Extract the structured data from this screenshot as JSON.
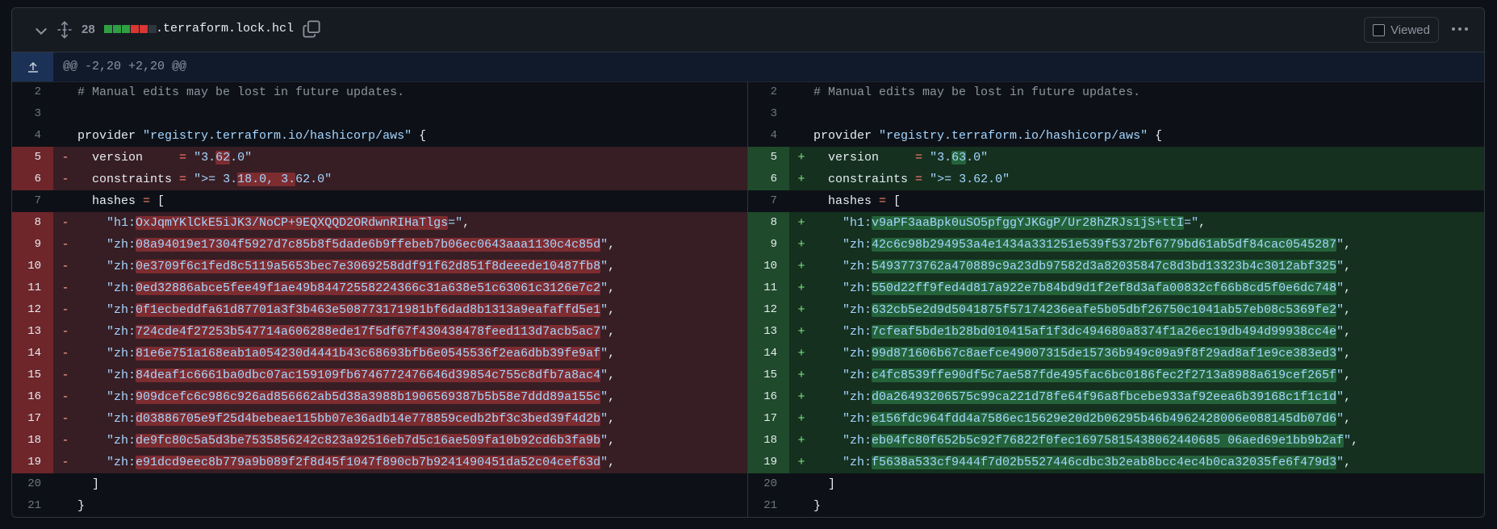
{
  "file_header": {
    "changes_count": "28",
    "diffstat": [
      "#2ea043",
      "#2ea043",
      "#2ea043",
      "#da3633",
      "#da3633",
      "#30363d"
    ],
    "file_name": ".terraform.lock.hcl",
    "viewed_label": "Viewed"
  },
  "hunk": {
    "header": "@@ -2,20 +2,20 @@"
  },
  "colors": {
    "deletion": "#371e24",
    "addition": "#15301f",
    "string": "#a5d6ff",
    "operator": "#ff7b72",
    "comment": "#8b949e"
  },
  "left_lines": [
    {
      "num": "2",
      "type": "ctx",
      "sign": "",
      "parts": [
        [
          "com",
          "# Manual edits may be lost in future updates."
        ]
      ]
    },
    {
      "num": "3",
      "type": "ctx",
      "sign": "",
      "parts": []
    },
    {
      "num": "4",
      "type": "ctx",
      "sign": "",
      "parts": [
        [
          "txt",
          "provider "
        ],
        [
          "str",
          "\"registry.terraform.io/hashicorp/aws\""
        ],
        [
          "txt",
          " {"
        ]
      ]
    },
    {
      "num": "5",
      "type": "del",
      "sign": "-",
      "parts": [
        [
          "txt",
          "  version     "
        ],
        [
          "op",
          "="
        ],
        [
          "txt",
          " "
        ],
        [
          "str",
          "\"3."
        ],
        [
          "hlstr",
          "62"
        ],
        [
          "str",
          ".0\""
        ]
      ]
    },
    {
      "num": "6",
      "type": "del",
      "sign": "-",
      "parts": [
        [
          "txt",
          "  constraints "
        ],
        [
          "op",
          "="
        ],
        [
          "txt",
          " "
        ],
        [
          "str",
          "\">= 3."
        ],
        [
          "hlstr",
          "18.0, 3."
        ],
        [
          "str",
          "62.0\""
        ]
      ]
    },
    {
      "num": "7",
      "type": "ctx",
      "sign": "",
      "parts": [
        [
          "txt",
          "  hashes "
        ],
        [
          "op",
          "="
        ],
        [
          "txt",
          " ["
        ]
      ]
    },
    {
      "num": "8",
      "type": "del",
      "sign": "-",
      "parts": [
        [
          "txt",
          "    "
        ],
        [
          "str",
          "\"h1:"
        ],
        [
          "hlstr",
          "OxJqmYKlCkE5iJK3/NoCP+9EQXQQD2ORdwnRIHaTlgs"
        ],
        [
          "str",
          "=\""
        ],
        [
          "txt",
          ","
        ]
      ]
    },
    {
      "num": "9",
      "type": "del",
      "sign": "-",
      "parts": [
        [
          "txt",
          "    "
        ],
        [
          "str",
          "\"zh:"
        ],
        [
          "hlstr",
          "08a94019e17304f5927d7c85b8f5dade6b9ffebeb7b06ec0643aaa1130c4c85d"
        ],
        [
          "str",
          "\""
        ],
        [
          "txt",
          ","
        ]
      ]
    },
    {
      "num": "10",
      "type": "del",
      "sign": "-",
      "parts": [
        [
          "txt",
          "    "
        ],
        [
          "str",
          "\"zh:"
        ],
        [
          "hlstr",
          "0e3709f6c1fed8c5119a5653bec7e3069258ddf91f62d851f8deeede10487fb8"
        ],
        [
          "str",
          "\""
        ],
        [
          "txt",
          ","
        ]
      ]
    },
    {
      "num": "11",
      "type": "del",
      "sign": "-",
      "parts": [
        [
          "txt",
          "    "
        ],
        [
          "str",
          "\"zh:"
        ],
        [
          "hlstr",
          "0ed32886abce5fee49f1ae49b84472558224366c31a638e51c63061c3126e7c2"
        ],
        [
          "str",
          "\""
        ],
        [
          "txt",
          ","
        ]
      ]
    },
    {
      "num": "12",
      "type": "del",
      "sign": "-",
      "parts": [
        [
          "txt",
          "    "
        ],
        [
          "str",
          "\"zh:"
        ],
        [
          "hlstr",
          "0f1ecbeddfa61d87701a3f3b463e508773171981bf6dad8b1313a9eafaffd5e1"
        ],
        [
          "str",
          "\""
        ],
        [
          "txt",
          ","
        ]
      ]
    },
    {
      "num": "13",
      "type": "del",
      "sign": "-",
      "parts": [
        [
          "txt",
          "    "
        ],
        [
          "str",
          "\"zh:"
        ],
        [
          "hlstr",
          "724cde4f27253b547714a606288ede17f5df67f430438478feed113d7acb5ac7"
        ],
        [
          "str",
          "\""
        ],
        [
          "txt",
          ","
        ]
      ]
    },
    {
      "num": "14",
      "type": "del",
      "sign": "-",
      "parts": [
        [
          "txt",
          "    "
        ],
        [
          "str",
          "\"zh:"
        ],
        [
          "hlstr",
          "81e6e751a168eab1a054230d4441b43c68693bfb6e0545536f2ea6dbb39fe9af"
        ],
        [
          "str",
          "\""
        ],
        [
          "txt",
          ","
        ]
      ]
    },
    {
      "num": "15",
      "type": "del",
      "sign": "-",
      "parts": [
        [
          "txt",
          "    "
        ],
        [
          "str",
          "\"zh:"
        ],
        [
          "hlstr",
          "84deaf1c6661ba0dbc07ac159109fb6746772476646d39854c755c8dfb7a8ac4"
        ],
        [
          "str",
          "\""
        ],
        [
          "txt",
          ","
        ]
      ]
    },
    {
      "num": "16",
      "type": "del",
      "sign": "-",
      "parts": [
        [
          "txt",
          "    "
        ],
        [
          "str",
          "\"zh:"
        ],
        [
          "hlstr",
          "909dcefc6c986c926ad856662ab5d38a3988b1906569387b5b58e7ddd89a155c"
        ],
        [
          "str",
          "\""
        ],
        [
          "txt",
          ","
        ]
      ]
    },
    {
      "num": "17",
      "type": "del",
      "sign": "-",
      "parts": [
        [
          "txt",
          "    "
        ],
        [
          "str",
          "\"zh:"
        ],
        [
          "hlstr",
          "d03886705e9f25d4bebeae115bb07e36adb14e778859cedb2bf3c3bed39f4d2b"
        ],
        [
          "str",
          "\""
        ],
        [
          "txt",
          ","
        ]
      ]
    },
    {
      "num": "18",
      "type": "del",
      "sign": "-",
      "parts": [
        [
          "txt",
          "    "
        ],
        [
          "str",
          "\"zh:"
        ],
        [
          "hlstr",
          "de9fc80c5a5d3be7535856242c823a92516eb7d5c16ae509fa10b92cd6b3fa9b"
        ],
        [
          "str",
          "\""
        ],
        [
          "txt",
          ","
        ]
      ]
    },
    {
      "num": "19",
      "type": "del",
      "sign": "-",
      "parts": [
        [
          "txt",
          "    "
        ],
        [
          "str",
          "\"zh:"
        ],
        [
          "hlstr",
          "e91dcd9eec8b779a9b089f2f8d45f1047f890cb7b9241490451da52c04cef63d"
        ],
        [
          "str",
          "\""
        ],
        [
          "txt",
          ","
        ]
      ]
    },
    {
      "num": "20",
      "type": "ctx",
      "sign": "",
      "parts": [
        [
          "txt",
          "  ]"
        ]
      ]
    },
    {
      "num": "21",
      "type": "ctx",
      "sign": "",
      "parts": [
        [
          "txt",
          "}"
        ]
      ]
    }
  ],
  "right_lines": [
    {
      "num": "2",
      "type": "ctx",
      "sign": "",
      "parts": [
        [
          "com",
          "# Manual edits may be lost in future updates."
        ]
      ]
    },
    {
      "num": "3",
      "type": "ctx",
      "sign": "",
      "parts": []
    },
    {
      "num": "4",
      "type": "ctx",
      "sign": "",
      "parts": [
        [
          "txt",
          "provider "
        ],
        [
          "str",
          "\"registry.terraform.io/hashicorp/aws\""
        ],
        [
          "txt",
          " {"
        ]
      ]
    },
    {
      "num": "5",
      "type": "add",
      "sign": "+",
      "parts": [
        [
          "txt",
          "  version     "
        ],
        [
          "op",
          "="
        ],
        [
          "txt",
          " "
        ],
        [
          "str",
          "\"3."
        ],
        [
          "hlstr",
          "63"
        ],
        [
          "str",
          ".0\""
        ]
      ]
    },
    {
      "num": "6",
      "type": "add",
      "sign": "+",
      "parts": [
        [
          "txt",
          "  constraints "
        ],
        [
          "op",
          "="
        ],
        [
          "txt",
          " "
        ],
        [
          "str",
          "\">= 3.62.0\""
        ]
      ]
    },
    {
      "num": "7",
      "type": "ctx",
      "sign": "",
      "parts": [
        [
          "txt",
          "  hashes "
        ],
        [
          "op",
          "="
        ],
        [
          "txt",
          " ["
        ]
      ]
    },
    {
      "num": "8",
      "type": "add",
      "sign": "+",
      "parts": [
        [
          "txt",
          "    "
        ],
        [
          "str",
          "\"h1:"
        ],
        [
          "hlstr",
          "v9aPF3aaBpk0uSO5pfggYJKGgP/Ur28hZRJs1jS+ttI"
        ],
        [
          "str",
          "=\""
        ],
        [
          "txt",
          ","
        ]
      ]
    },
    {
      "num": "9",
      "type": "add",
      "sign": "+",
      "parts": [
        [
          "txt",
          "    "
        ],
        [
          "str",
          "\"zh:"
        ],
        [
          "hlstr",
          "42c6c98b294953a4e1434a331251e539f5372bf6779bd61ab5df84cac0545287"
        ],
        [
          "str",
          "\""
        ],
        [
          "txt",
          ","
        ]
      ]
    },
    {
      "num": "10",
      "type": "add",
      "sign": "+",
      "parts": [
        [
          "txt",
          "    "
        ],
        [
          "str",
          "\"zh:"
        ],
        [
          "hlstr",
          "5493773762a470889c9a23db97582d3a82035847c8d3bd13323b4c3012abf325"
        ],
        [
          "str",
          "\""
        ],
        [
          "txt",
          ","
        ]
      ]
    },
    {
      "num": "11",
      "type": "add",
      "sign": "+",
      "parts": [
        [
          "txt",
          "    "
        ],
        [
          "str",
          "\"zh:"
        ],
        [
          "hlstr",
          "550d22ff9fed4d817a922e7b84bd9d1f2ef8d3afa00832cf66b8cd5f0e6dc748"
        ],
        [
          "str",
          "\""
        ],
        [
          "txt",
          ","
        ]
      ]
    },
    {
      "num": "12",
      "type": "add",
      "sign": "+",
      "parts": [
        [
          "txt",
          "    "
        ],
        [
          "str",
          "\"zh:"
        ],
        [
          "hlstr",
          "632cb5e2d9d5041875f57174236eafe5b05dbf26750c1041ab57eb08c5369fe2"
        ],
        [
          "str",
          "\""
        ],
        [
          "txt",
          ","
        ]
      ]
    },
    {
      "num": "13",
      "type": "add",
      "sign": "+",
      "parts": [
        [
          "txt",
          "    "
        ],
        [
          "str",
          "\"zh:"
        ],
        [
          "hlstr",
          "7cfeaf5bde1b28bd010415af1f3dc494680a8374f1a26ec19db494d99938cc4e"
        ],
        [
          "str",
          "\""
        ],
        [
          "txt",
          ","
        ]
      ]
    },
    {
      "num": "14",
      "type": "add",
      "sign": "+",
      "parts": [
        [
          "txt",
          "    "
        ],
        [
          "str",
          "\"zh:"
        ],
        [
          "hlstr",
          "99d871606b67c8aefce49007315de15736b949c09a9f8f29ad8af1e9ce383ed3"
        ],
        [
          "str",
          "\""
        ],
        [
          "txt",
          ","
        ]
      ]
    },
    {
      "num": "15",
      "type": "add",
      "sign": "+",
      "parts": [
        [
          "txt",
          "    "
        ],
        [
          "str",
          "\"zh:"
        ],
        [
          "hlstr",
          "c4fc8539ffe90df5c7ae587fde495fac6bc0186fec2f2713a8988a619cef265f"
        ],
        [
          "str",
          "\""
        ],
        [
          "txt",
          ","
        ]
      ]
    },
    {
      "num": "16",
      "type": "add",
      "sign": "+",
      "parts": [
        [
          "txt",
          "    "
        ],
        [
          "str",
          "\"zh:"
        ],
        [
          "hlstr",
          "d0a26493206575c99ca221d78fe64f96a8fbcebe933af92eea6b39168c1f1c1d"
        ],
        [
          "str",
          "\""
        ],
        [
          "txt",
          ","
        ]
      ]
    },
    {
      "num": "17",
      "type": "add",
      "sign": "+",
      "parts": [
        [
          "txt",
          "    "
        ],
        [
          "str",
          "\"zh:"
        ],
        [
          "hlstr",
          "e156fdc964fdd4a7586ec15629e20d2b06295b46b4962428006e088145db07d6"
        ],
        [
          "str",
          "\""
        ],
        [
          "txt",
          ","
        ]
      ]
    },
    {
      "num": "18",
      "type": "add",
      "sign": "+",
      "parts": [
        [
          "txt",
          "    "
        ],
        [
          "str",
          "\"zh:"
        ],
        [
          "hlstr",
          "eb04fc80f652b5c92f76822f0fec16975815438062440685 06aed69e1bb9b2af"
        ],
        [
          "str",
          "\""
        ],
        [
          "txt",
          ","
        ]
      ]
    },
    {
      "num": "19",
      "type": "add",
      "sign": "+",
      "parts": [
        [
          "txt",
          "    "
        ],
        [
          "str",
          "\"zh:"
        ],
        [
          "hlstr",
          "f5638a533cf9444f7d02b5527446cdbc3b2eab8bcc4ec4b0ca32035fe6f479d3"
        ],
        [
          "str",
          "\""
        ],
        [
          "txt",
          ","
        ]
      ]
    },
    {
      "num": "20",
      "type": "ctx",
      "sign": "",
      "parts": [
        [
          "txt",
          "  ]"
        ]
      ]
    },
    {
      "num": "21",
      "type": "ctx",
      "sign": "",
      "parts": [
        [
          "txt",
          "}"
        ]
      ]
    }
  ]
}
